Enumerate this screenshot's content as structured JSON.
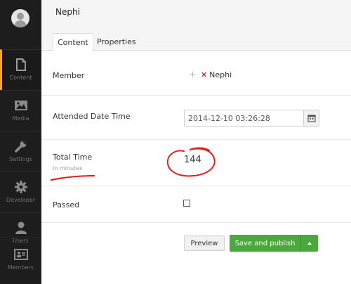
{
  "sidebar": {
    "items": [
      {
        "label": "Content",
        "icon": "document-icon"
      },
      {
        "label": "Media",
        "icon": "image-icon"
      },
      {
        "label": "Settings",
        "icon": "wrench-icon"
      },
      {
        "label": "Developer",
        "icon": "gear-icon"
      },
      {
        "label": "Users",
        "icon": "user-icon"
      },
      {
        "label": "Members",
        "icon": "id-card-icon"
      }
    ],
    "active": "Content"
  },
  "header": {
    "title": "Nephi",
    "tabs": [
      {
        "label": "Content",
        "active": true
      },
      {
        "label": "Properties",
        "active": false
      }
    ]
  },
  "form": {
    "member": {
      "label": "Member",
      "value": "Nephi"
    },
    "attended": {
      "label": "Attended Date Time",
      "value": "2014-12-10 03:26:28"
    },
    "total": {
      "label": "Total Time",
      "sublabel": "In minutes",
      "value": "144"
    },
    "passed": {
      "label": "Passed",
      "checked": false
    }
  },
  "actions": {
    "preview_label": "Preview",
    "publish_label": "Save and publish"
  },
  "colors": {
    "sidebar_bg": "#1d1d1d",
    "active_accent": "#f5a623",
    "publish_green": "#4aa83c",
    "remove_red": "#d0021b",
    "annotation_red": "#e0201a"
  }
}
